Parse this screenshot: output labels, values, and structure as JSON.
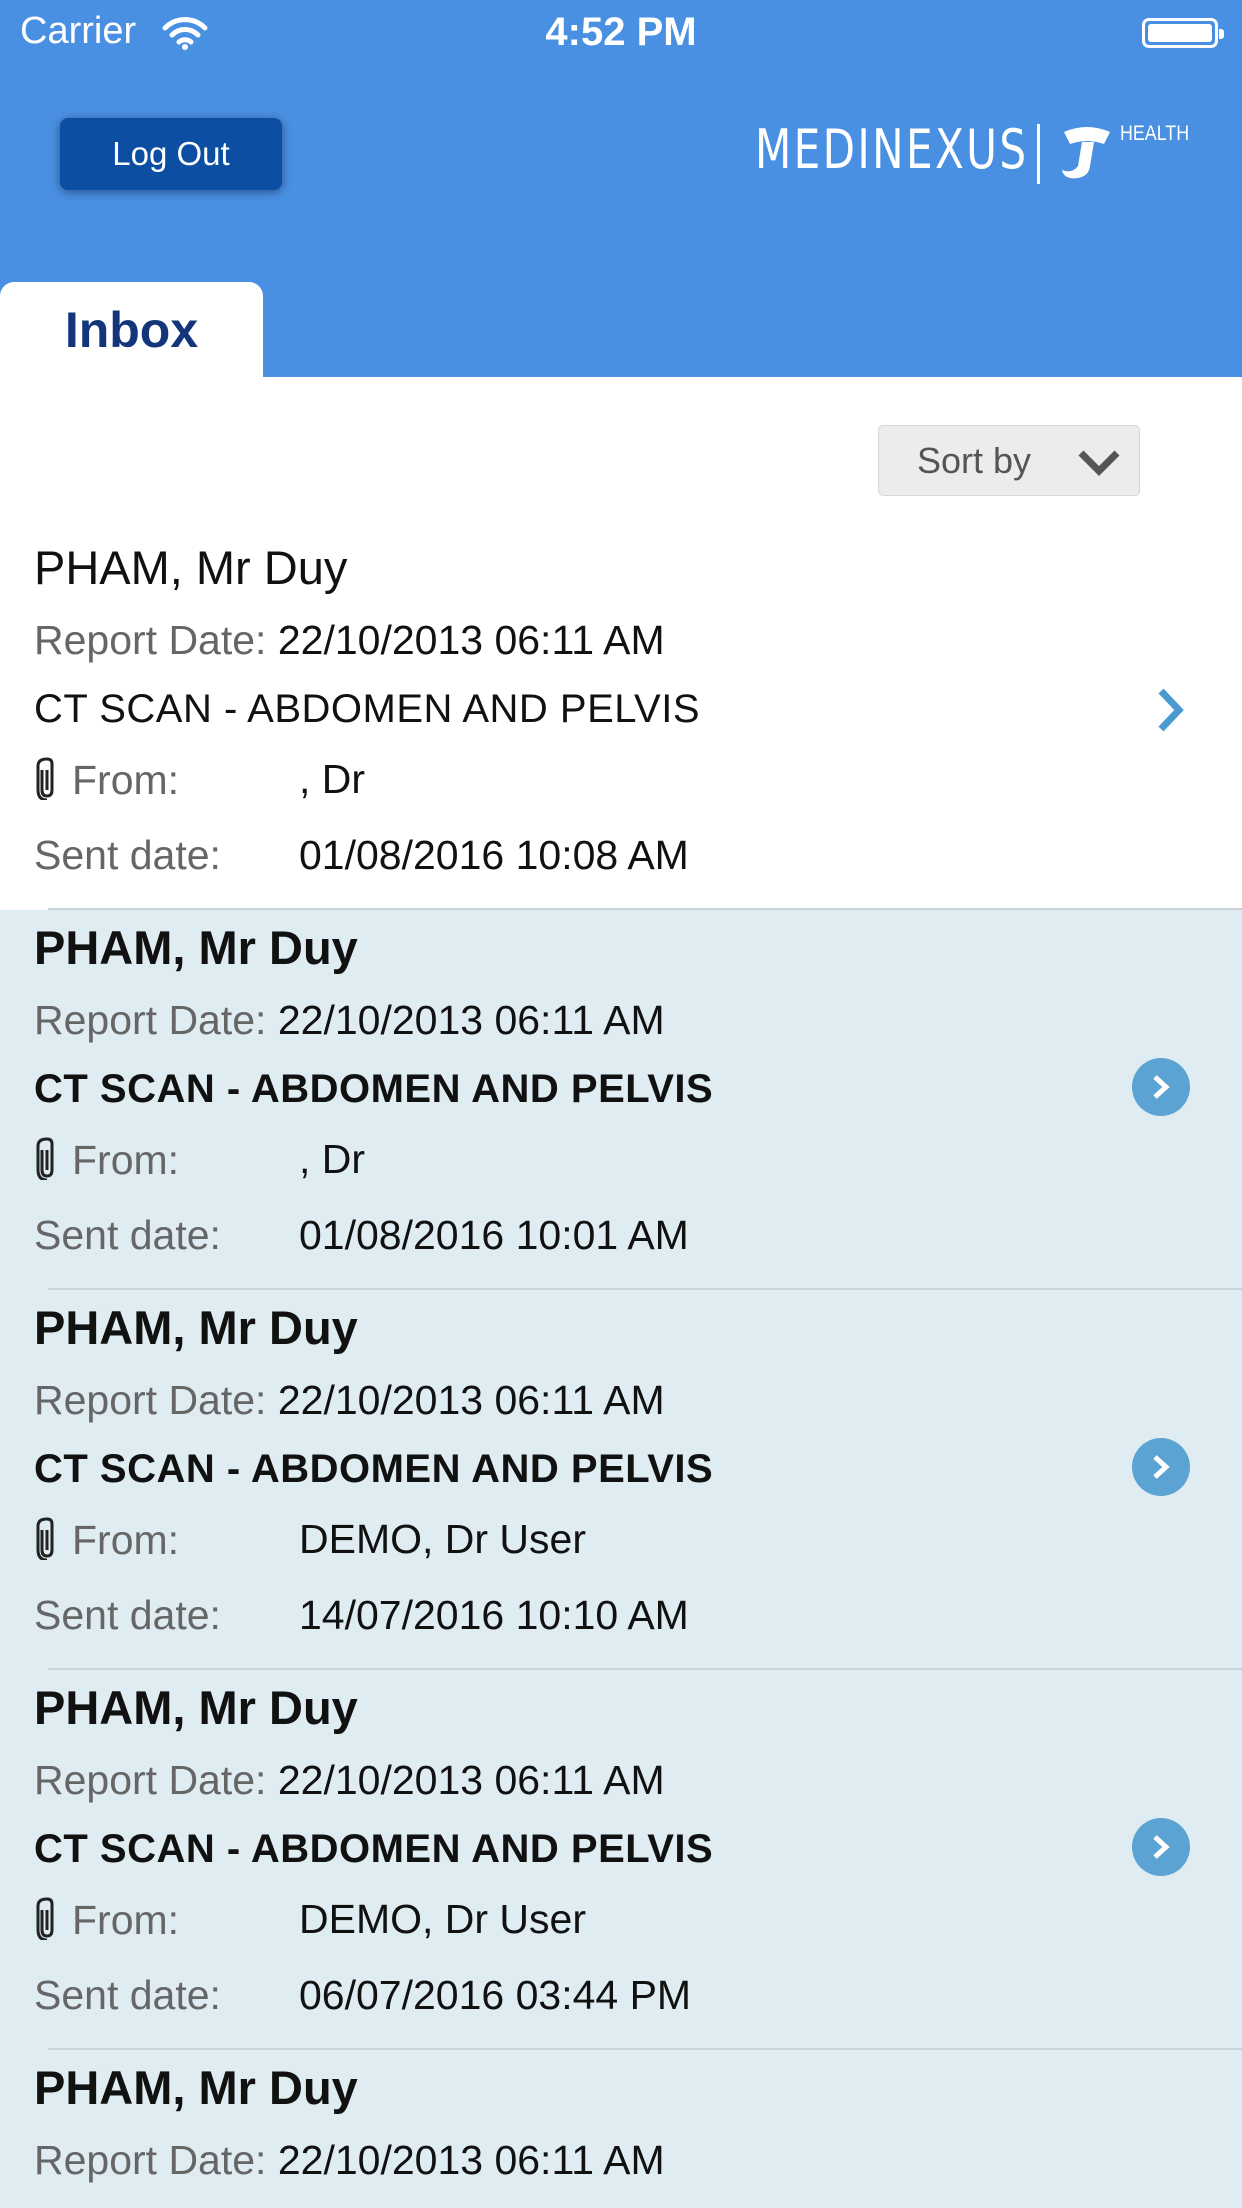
{
  "status_bar": {
    "carrier": "Carrier",
    "time": "4:52 PM",
    "wifi_icon": "wifi-icon",
    "battery_icon": "battery-icon"
  },
  "header": {
    "logout_label": "Log Out",
    "brand_name": "MEDINEXUS",
    "brand_sub": "HEALTH",
    "brand_mark_icon": "telstra-logo-icon",
    "background_color": "#4a90e2"
  },
  "tabs": [
    {
      "label": "Inbox",
      "active": true
    }
  ],
  "sort": {
    "label": "Sort by",
    "icon": "chevron-down-icon"
  },
  "labels": {
    "report_date": "Report Date:",
    "from": "From:",
    "sent_date": "Sent date:"
  },
  "colors": {
    "unread_row": "#dfedf3",
    "read_row": "#ffffff",
    "chevron": "#4a9ad1"
  },
  "messages": [
    {
      "patient": "PHAM, Mr Duy",
      "report_date": "22/10/2013 06:11 AM",
      "title": "CT SCAN - ABDOMEN AND PELVIS",
      "from": ", Dr",
      "sent_date": "01/08/2016 10:08 AM",
      "read": true,
      "attachment_icon": "paperclip-icon"
    },
    {
      "patient": "PHAM, Mr Duy",
      "report_date": "22/10/2013 06:11 AM",
      "title": "CT SCAN - ABDOMEN AND PELVIS",
      "from": ", Dr",
      "sent_date": "01/08/2016 10:01 AM",
      "read": false,
      "attachment_icon": "paperclip-icon"
    },
    {
      "patient": "PHAM, Mr Duy",
      "report_date": "22/10/2013 06:11 AM",
      "title": "CT SCAN - ABDOMEN AND PELVIS",
      "from": "DEMO, Dr User",
      "sent_date": "14/07/2016 10:10 AM",
      "read": false,
      "attachment_icon": "paperclip-icon"
    },
    {
      "patient": "PHAM, Mr Duy",
      "report_date": "22/10/2013 06:11 AM",
      "title": "CT SCAN - ABDOMEN AND PELVIS",
      "from": "DEMO, Dr User",
      "sent_date": "06/07/2016 03:44 PM",
      "read": false,
      "attachment_icon": "paperclip-icon"
    },
    {
      "patient": "PHAM, Mr Duy",
      "report_date": "22/10/2013 06:11 AM",
      "read": false
    }
  ]
}
